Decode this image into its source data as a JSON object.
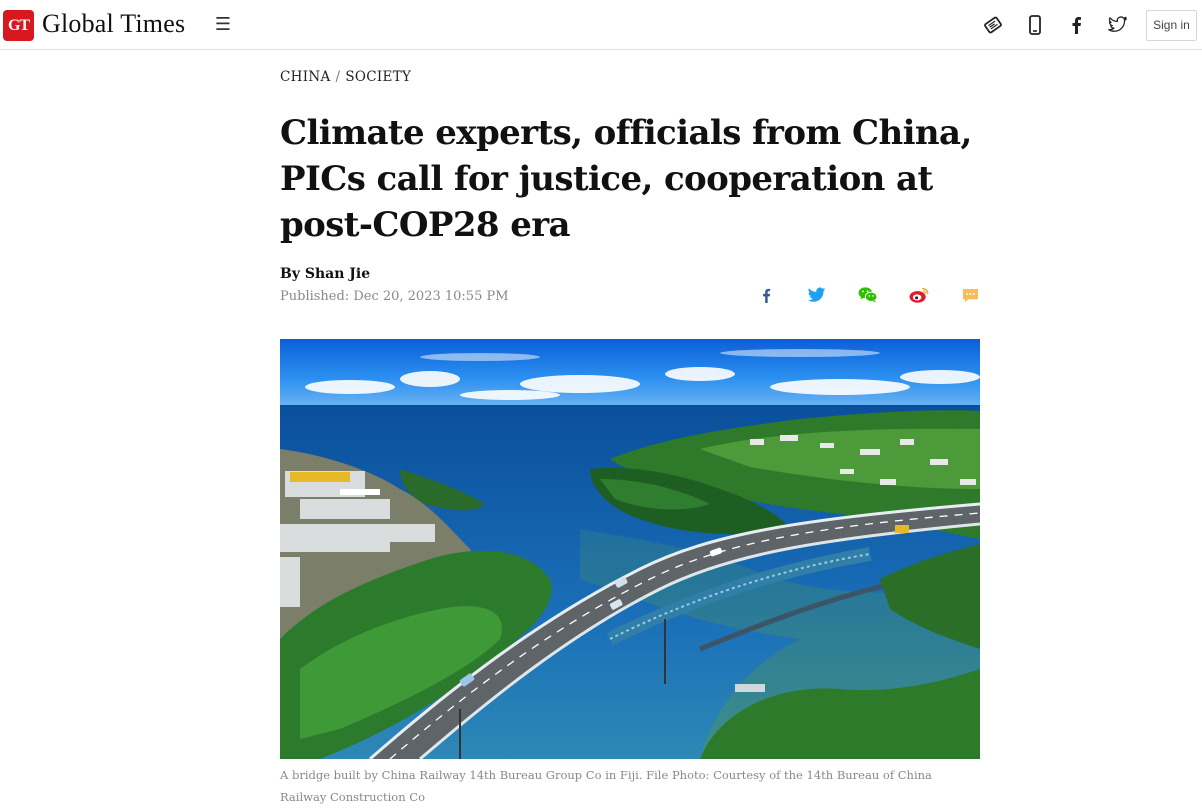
{
  "header": {
    "logo_mark": "GT",
    "logo_text": "Global Times",
    "menu_glyph": "☰",
    "signin_label": "Sign in"
  },
  "article": {
    "breadcrumb": [
      "CHINA",
      "SOCIETY"
    ],
    "breadcrumb_separator": "/",
    "headline": "Climate experts, officials from China, PICs call for justice, cooperation at post-COP28 era",
    "byline": "By Shan Jie",
    "published": "Published: Dec 20, 2023 10:55 PM",
    "image_caption": "A bridge built by China Railway 14th Bureau Group Co in Fiji. File Photo: Courtesy of the 14th Bureau of China Railway Construction Co"
  },
  "colors": {
    "brand_red": "#d7191f",
    "facebook": "#3b5998",
    "twitter": "#1da1f2",
    "wechat": "#2dc100",
    "weibo": "#e6162d",
    "comment": "#f5a623"
  },
  "icons": {
    "header": [
      "app-icon",
      "mobile-icon",
      "facebook-icon",
      "twitter-icon"
    ],
    "share": [
      "facebook-share-icon",
      "twitter-share-icon",
      "wechat-share-icon",
      "weibo-share-icon",
      "comment-icon"
    ]
  }
}
